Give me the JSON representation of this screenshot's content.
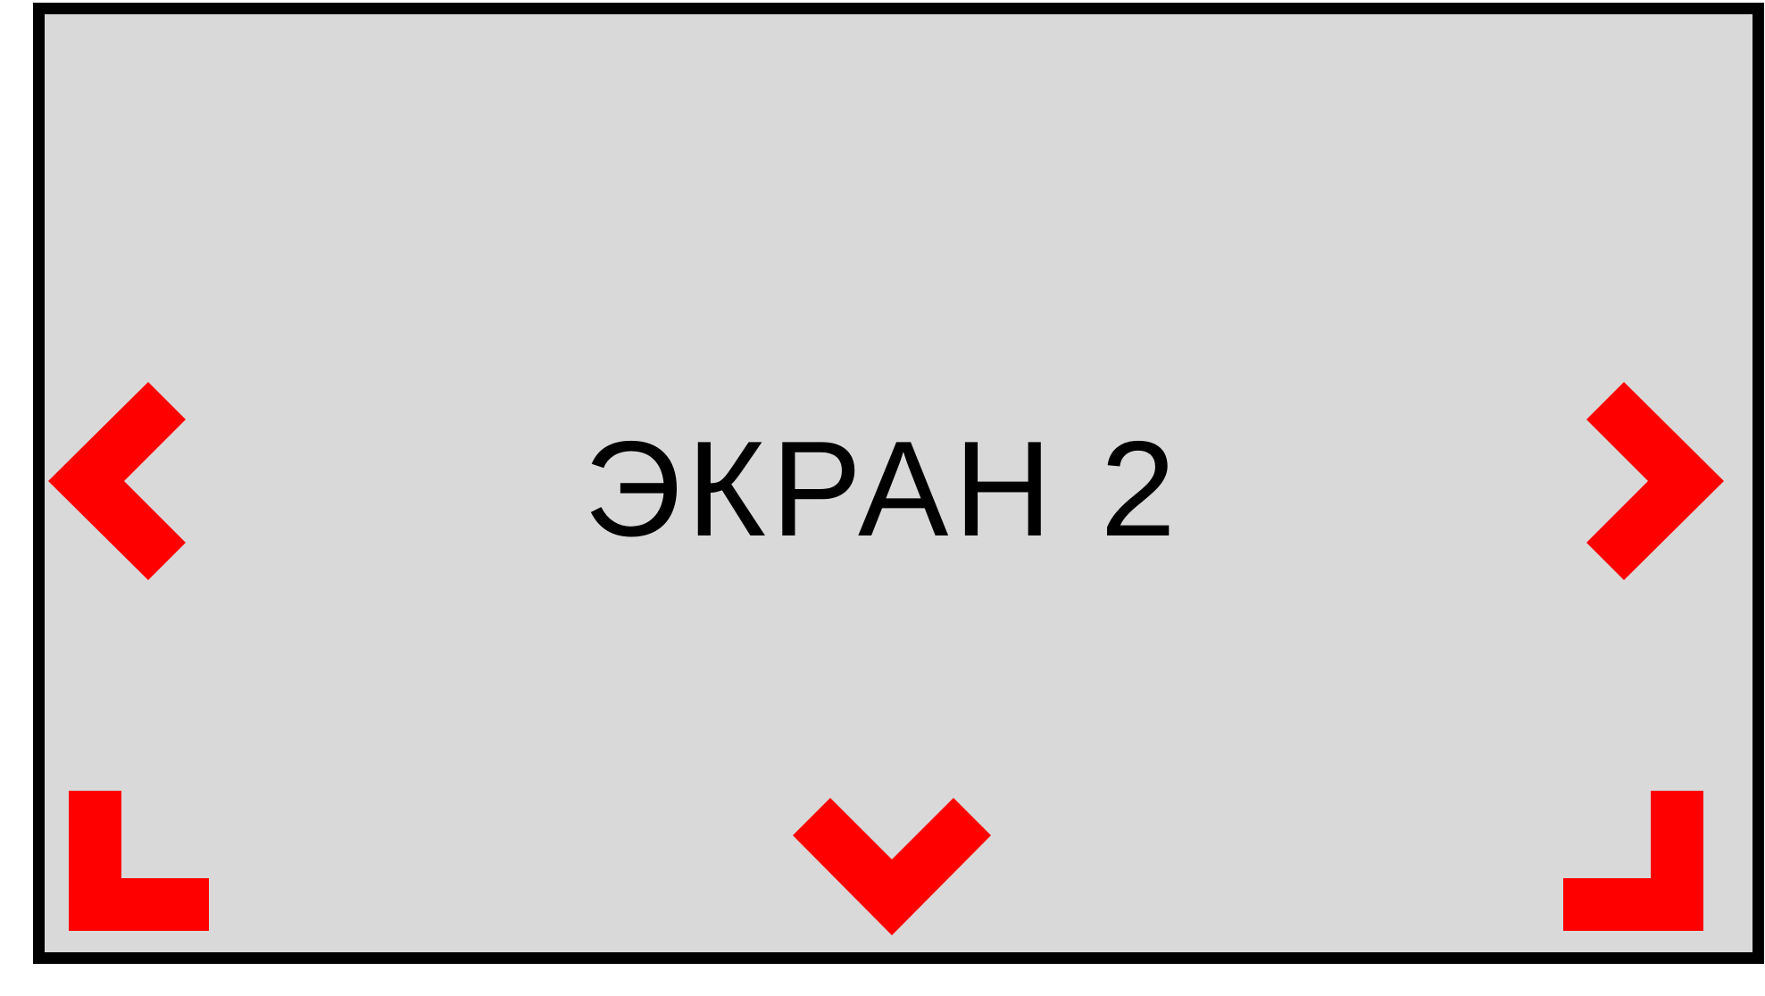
{
  "screen": {
    "title": "ЭКРАН 2",
    "background_color": "#d9d9d9",
    "border_color": "#000000",
    "text_color": "#000000"
  },
  "navigation": {
    "arrow_color": "#ff0000",
    "controls": [
      {
        "name": "left",
        "icon": "chevron-left-icon"
      },
      {
        "name": "right",
        "icon": "chevron-right-icon"
      },
      {
        "name": "down",
        "icon": "chevron-down-icon"
      },
      {
        "name": "bottom-left",
        "icon": "corner-bottom-left-icon"
      },
      {
        "name": "bottom-right",
        "icon": "corner-bottom-right-icon"
      }
    ]
  }
}
